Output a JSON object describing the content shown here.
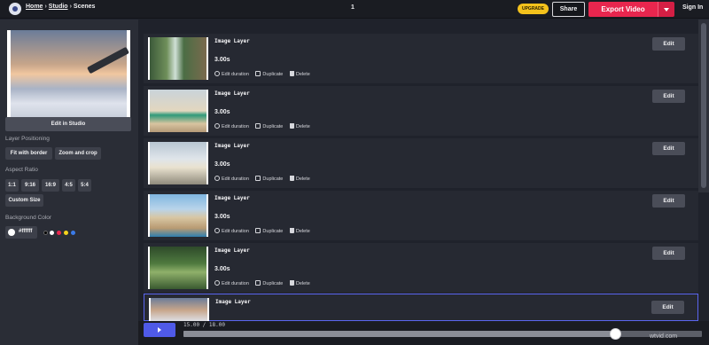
{
  "header": {
    "breadcrumb": [
      "Home",
      "Studio",
      "Scenes"
    ],
    "separator": "›",
    "page_number": "1",
    "upgrade_label": "UPGRADE",
    "share_label": "Share",
    "export_label": "Export Video",
    "signin_label": "Sign In"
  },
  "sidebar": {
    "edit_in_studio": "Edit in Studio",
    "layer_positioning_label": "Layer Positioning",
    "positioning_options": [
      "Fit with border",
      "Zoom and crop"
    ],
    "aspect_ratio_label": "Aspect Ratio",
    "aspect_ratios": [
      "1:1",
      "9:16",
      "16:9",
      "4:5",
      "5:4"
    ],
    "custom_size_label": "Custom Size",
    "background_color_label": "Background Color",
    "background_color_value": "#ffffff",
    "swatches": [
      "#000000",
      "#ffffff",
      "#e8264e",
      "#f4d21c",
      "#3b7be8"
    ]
  },
  "scenes": [
    {
      "title": "Image Layer",
      "duration": "3.00s",
      "edit_duration": "Edit duration",
      "duplicate": "Duplicate",
      "delete": "Delete",
      "edit": "Edit",
      "thumb_icon": "waterfall-photo"
    },
    {
      "title": "Image Layer",
      "duration": "3.00s",
      "edit_duration": "Edit duration",
      "duplicate": "Duplicate",
      "delete": "Delete",
      "edit": "Edit",
      "thumb_icon": "plant-photo"
    },
    {
      "title": "Image Layer",
      "duration": "3.00s",
      "edit_duration": "Edit duration",
      "duplicate": "Duplicate",
      "delete": "Delete",
      "edit": "Edit",
      "thumb_icon": "map-photo"
    },
    {
      "title": "Image Layer",
      "duration": "3.00s",
      "edit_duration": "Edit duration",
      "duplicate": "Duplicate",
      "delete": "Delete",
      "edit": "Edit",
      "thumb_icon": "ruins-photo"
    },
    {
      "title": "Image Layer",
      "duration": "3.00s",
      "edit_duration": "Edit duration",
      "duplicate": "Duplicate",
      "delete": "Delete",
      "edit": "Edit",
      "thumb_icon": "forest-photo"
    },
    {
      "title": "Image Layer",
      "duration": "",
      "edit_duration": "",
      "duplicate": "",
      "delete": "",
      "edit": "Edit",
      "thumb_icon": "sky-photo"
    }
  ],
  "timeline": {
    "time_display": "15.00 / 18.00",
    "progress": 0.8333
  },
  "watermark": "wtvid.com",
  "colors": {
    "accent": "#4f5ae8",
    "export": "#e8264e",
    "upgrade": "#f4c21c"
  }
}
